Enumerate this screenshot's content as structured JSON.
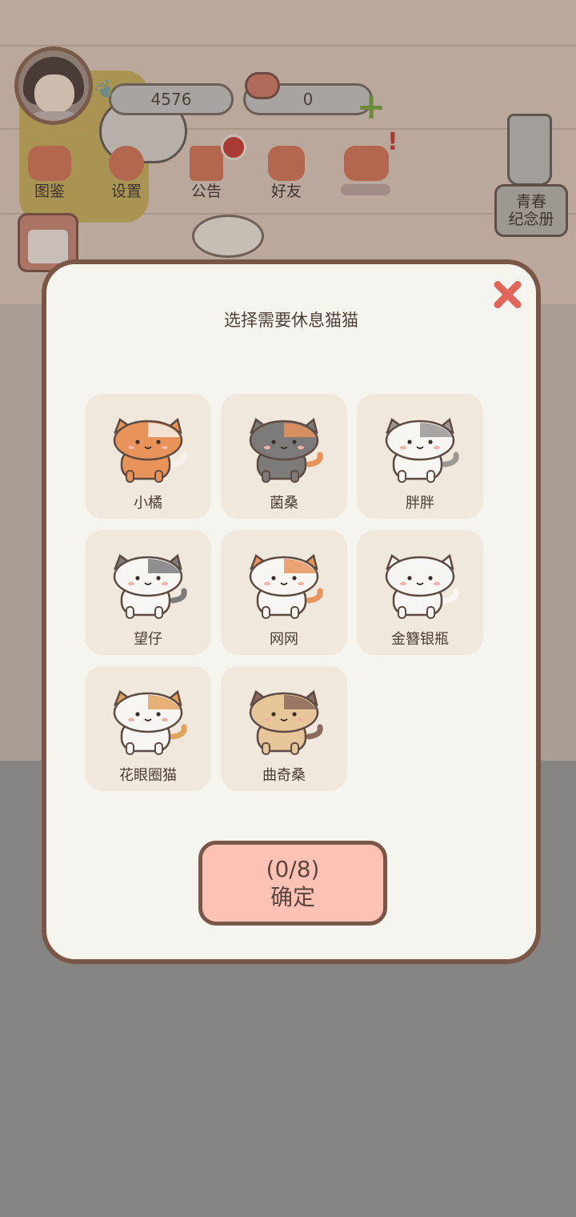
{
  "hud": {
    "fish_count": "4576",
    "heart_count": "0"
  },
  "menu": [
    {
      "label": "图鉴",
      "icon": "cat-book-icon"
    },
    {
      "label": "设置",
      "icon": "gear-icon"
    },
    {
      "label": "公告",
      "icon": "gift-icon"
    },
    {
      "label": "好友",
      "icon": "friends-icon"
    },
    {
      "label": "",
      "icon": "heart-mail-icon"
    }
  ],
  "memorial_label": "青春\n纪念册",
  "modal": {
    "title": "选择需要休息猫猫",
    "cats": [
      {
        "name": "小橘",
        "body": "#e8935a",
        "accent": "#f5f0ea",
        "ear": "#e8935a"
      },
      {
        "name": "菌桑",
        "body": "#7d7a7a",
        "accent": "#e8935a",
        "ear": "#7d7a7a"
      },
      {
        "name": "胖胖",
        "body": "#f8f6f3",
        "accent": "#9a9795",
        "ear": "#9a9795"
      },
      {
        "name": "望仔",
        "body": "#f8f6f3",
        "accent": "#7e7b7b",
        "ear": "#7e7b7b"
      },
      {
        "name": "网网",
        "body": "#f8f6f3",
        "accent": "#e8935a",
        "ear": "#e8935a"
      },
      {
        "name": "金簪银瓶",
        "body": "#f8f6f3",
        "accent": "#f8f6f3",
        "ear": "#f8f6f3"
      },
      {
        "name": "花眼圈猫",
        "body": "#f8f6f3",
        "accent": "#e2a25e",
        "ear": "#e2a25e"
      },
      {
        "name": "曲奇桑",
        "body": "#e7c79a",
        "accent": "#8a6a5a",
        "ear": "#8a6a5a"
      }
    ],
    "count_label": "(0/8)",
    "confirm_label": "确定"
  },
  "colors": {
    "modal_border": "#7a5647",
    "modal_bg": "#f6f4ef",
    "card_bg": "#f0e8dc",
    "confirm_bg": "#fdc2b6",
    "close": "#e0655b"
  }
}
